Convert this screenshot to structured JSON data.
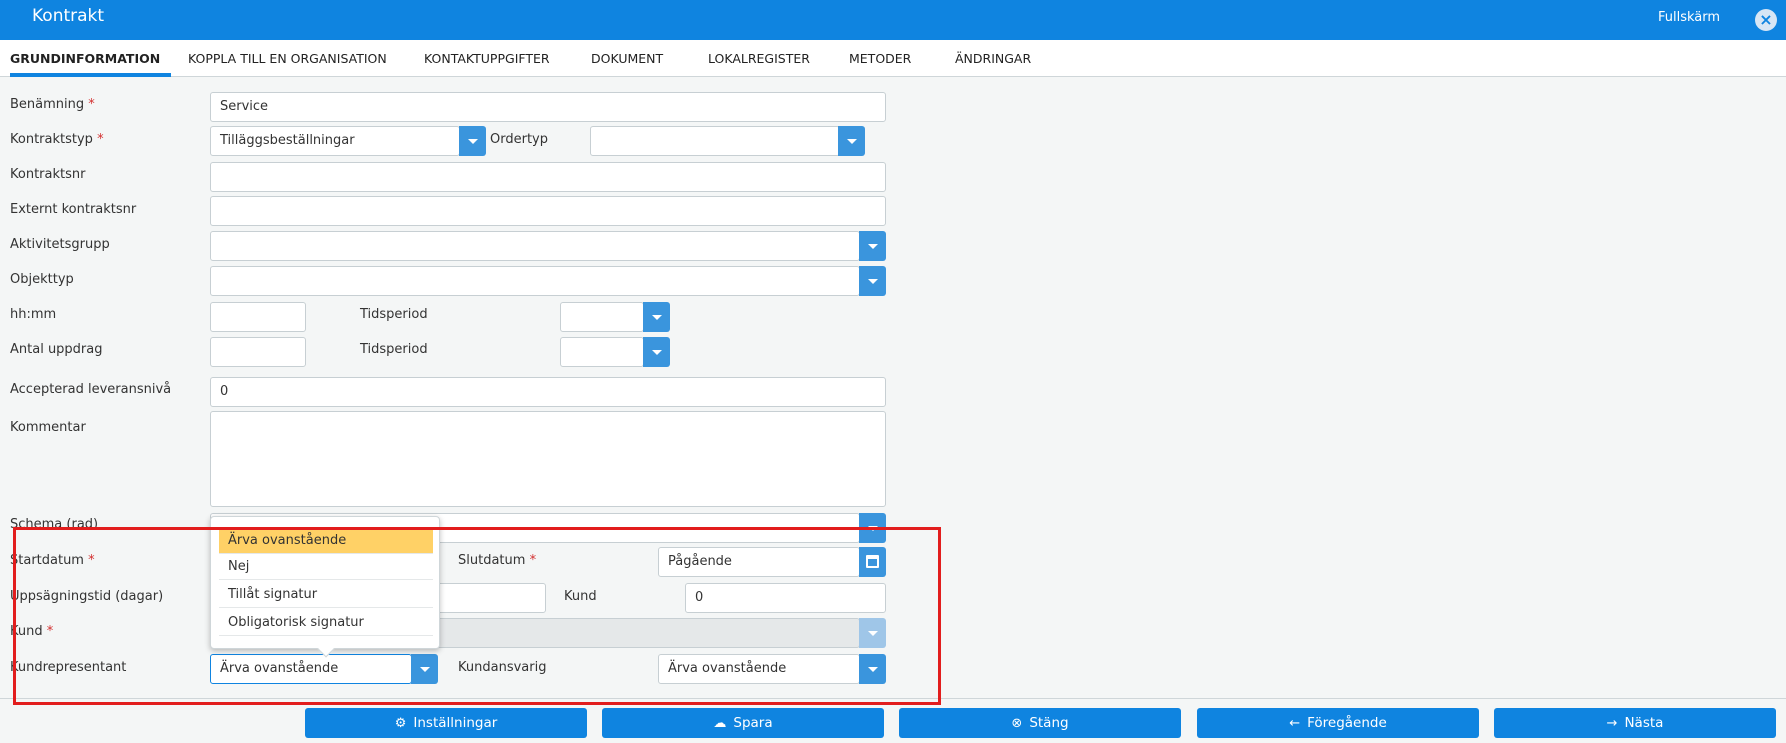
{
  "window": {
    "title": "Kontrakt",
    "fullscreen_label": "Fullskärm",
    "close_icon": "close-circle-icon"
  },
  "tabs": [
    {
      "label": "GRUNDINFORMATION",
      "active": true
    },
    {
      "label": "KOPPLA TILL EN ORGANISATION"
    },
    {
      "label": "KONTAKTUPPGIFTER"
    },
    {
      "label": "DOKUMENT"
    },
    {
      "label": "LOKALREGISTER"
    },
    {
      "label": "METODER"
    },
    {
      "label": "ÄNDRINGAR"
    }
  ],
  "form": {
    "benamning": {
      "label": "Benämning",
      "required": "*",
      "value": "Service"
    },
    "kontraktstyp": {
      "label": "Kontraktstyp",
      "required": "*",
      "value": "Tilläggsbeställningar"
    },
    "ordertyp": {
      "label": "Ordertyp",
      "value": ""
    },
    "kontraktsnr": {
      "label": "Kontraktsnr",
      "value": ""
    },
    "externt_kontraktsnr": {
      "label": "Externt kontraktsnr",
      "value": ""
    },
    "aktivitetsgrupp": {
      "label": "Aktivitetsgrupp",
      "value": ""
    },
    "objekttyp": {
      "label": "Objekttyp",
      "value": ""
    },
    "hhmm": {
      "label": "hh:mm",
      "value": ""
    },
    "tidsperiod_1": {
      "label": "Tidsperiod",
      "value": ""
    },
    "antal_uppdrag": {
      "label": "Antal uppdrag",
      "value": ""
    },
    "tidsperiod_2": {
      "label": "Tidsperiod",
      "value": ""
    },
    "accepterad_leveransniva": {
      "label": "Accepterad leveransnivå",
      "value": "0"
    },
    "kommentar": {
      "label": "Kommentar",
      "value": ""
    },
    "schema": {
      "label": "Schema (rad)"
    },
    "startdatum": {
      "label": "Startdatum",
      "required": "*"
    },
    "slutdatum": {
      "label": "Slutdatum",
      "required": "*",
      "value": "Pågående"
    },
    "uppsagningstid": {
      "label": "Uppsägningstid (dagar)",
      "value": ""
    },
    "kund_small": {
      "label": "Kund",
      "value": "0"
    },
    "kund": {
      "label": "Kund",
      "required": "*",
      "value": ""
    },
    "kundrepresentant": {
      "label": "Kundrepresentant",
      "value": "Ärva ovanstående"
    },
    "kundansvarig": {
      "label": "Kundansvarig",
      "value": "Ärva ovanstående"
    }
  },
  "dropdown_popup": {
    "options": [
      "Ärva ovanstående",
      "Nej",
      "Tillåt signatur",
      "Obligatorisk signatur"
    ],
    "selected_index": 0
  },
  "footer": {
    "buttons": [
      {
        "label": "Inställningar",
        "icon": "gear-icon"
      },
      {
        "label": "Spara",
        "icon": "cloud-upload-icon"
      },
      {
        "label": "Stäng",
        "icon": "close-circle-icon"
      },
      {
        "label": "Föregående",
        "icon": "arrow-left-icon"
      },
      {
        "label": "Nästa",
        "icon": "arrow-right-icon"
      }
    ]
  },
  "colors": {
    "accent": "#0f84e0",
    "dropdown_button": "#3a95dd",
    "selected_option": "#ffd166",
    "annotation_box": "#e21d1d",
    "required_marker": "#d32f2f"
  }
}
